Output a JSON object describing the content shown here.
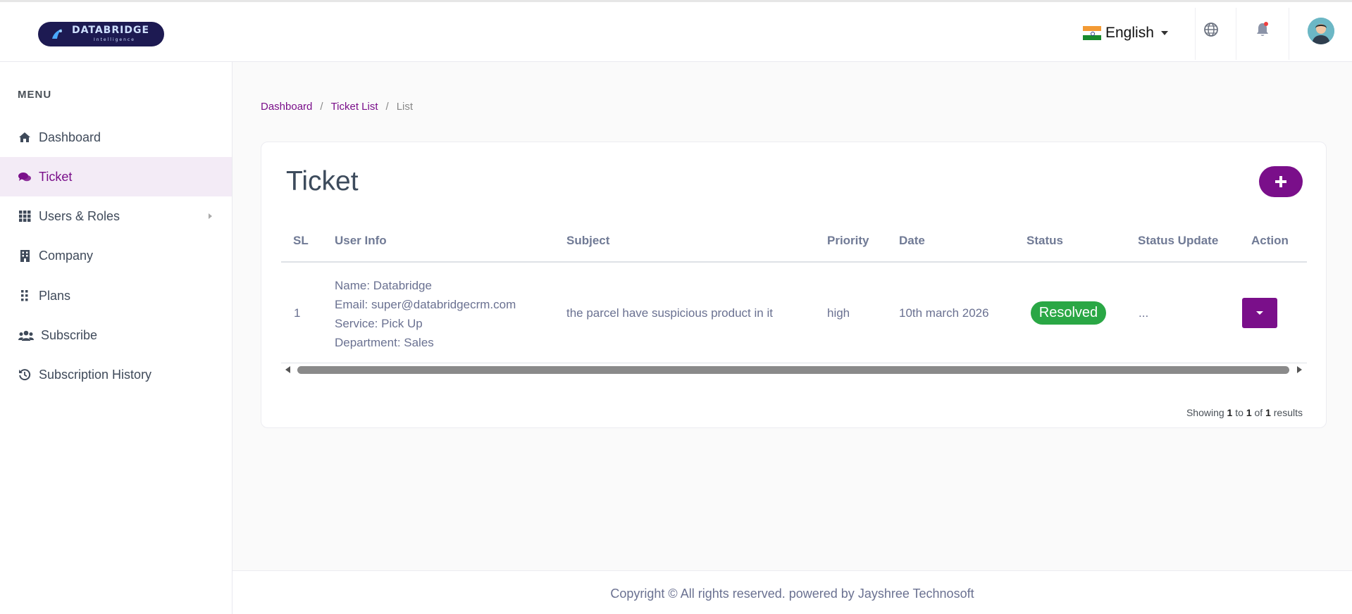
{
  "header": {
    "logo_text": "DATABRIDGE",
    "logo_sub": "Intelligence",
    "language": "English"
  },
  "sidebar": {
    "menu_title": "MENU",
    "items": [
      {
        "label": "Dashboard",
        "icon": "home-icon"
      },
      {
        "label": "Ticket",
        "icon": "comments-icon",
        "active": true
      },
      {
        "label": "Users & Roles",
        "icon": "grid-icon",
        "has_submenu": true
      },
      {
        "label": "Company",
        "icon": "building-icon"
      },
      {
        "label": "Plans",
        "icon": "dots-grid-icon"
      },
      {
        "label": "Subscribe",
        "icon": "users-icon"
      },
      {
        "label": "Subscription History",
        "icon": "history-icon"
      }
    ]
  },
  "breadcrumb": {
    "items": [
      "Dashboard",
      "Ticket List"
    ],
    "current": "List"
  },
  "card": {
    "title": "Ticket",
    "columns": [
      "SL",
      "User Info",
      "Subject",
      "Priority",
      "Date",
      "Status",
      "Status Update",
      "Action"
    ],
    "rows": [
      {
        "sl": "1",
        "user_info": {
          "name": "Name: Databridge",
          "email": "Email: super@databridgecrm.com",
          "service": "Service: Pick Up",
          "department": "Department: Sales"
        },
        "subject": "the parcel have suspicious product in it",
        "priority": "high",
        "date": "10th march 2026",
        "status": "Resolved",
        "status_update": "..."
      }
    ],
    "pagination": {
      "prefix": "Showing",
      "from": "1",
      "to_word": "to",
      "to": "1",
      "of_word": "of",
      "total": "1",
      "suffix": "results"
    }
  },
  "footer": {
    "text": "Copyright © All rights reserved. powered by Jayshree Technosoft"
  },
  "colors": {
    "accent": "#7a0f8a",
    "status_resolved": "#2aa745",
    "sidebar_active_bg": "#f3ebf6"
  }
}
